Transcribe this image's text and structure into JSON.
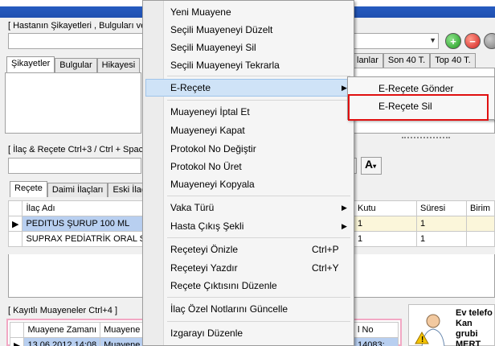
{
  "complaints_section": {
    "label": "[ Hastanın Şikayetleri , Bulguları ve",
    "tabs": [
      "Şikayetler",
      "Bulgular",
      "Hikayesi"
    ],
    "right_tabs": [
      "lanlar",
      "Son 40 T.",
      "Top 40 T."
    ]
  },
  "drug_section": {
    "label": "[ İlaç & Reçete Ctrl+3 / Ctrl + Spac",
    "font_button": "A",
    "tabs": [
      "Reçete",
      "Daimi İlaçları",
      "Eski İlaçla"
    ],
    "columns": {
      "drug": "İlaç Adı",
      "box": "Kutu",
      "duration": "Süresi",
      "unit": "Birim"
    },
    "rows": [
      {
        "drug": "PEDITUS ŞURUP 100 ML",
        "box": "1",
        "duration": "1",
        "selected": true
      },
      {
        "drug": "SUPRAX PEDİATRİK ORAL SÜ",
        "box": "1",
        "duration": "1",
        "selected": false
      }
    ]
  },
  "visits_section": {
    "label": "[ Kayıtlı Muayeneler Ctrl+4 ]",
    "columns": [
      "Muayene Zamanı",
      "Muayene",
      "l No"
    ],
    "row": {
      "time": "13.06.2012 14:08",
      "type": "Muayene",
      "no": "14083:"
    }
  },
  "patient_info": {
    "line1": "Ev telefo",
    "line2": "Kan grubi",
    "line3": "MERT ŞA"
  },
  "context_menu": {
    "items": [
      {
        "label": "Yeni Muayene"
      },
      {
        "label": "Seçili Muayeneyi Düzelt"
      },
      {
        "label": "Seçili Muayeneyi Sil"
      },
      {
        "label": "Seçili Muayeneyi Tekrarla"
      },
      {
        "label": "E-Reçete",
        "submenu": true
      },
      {
        "label": "Muayeneyi İptal Et"
      },
      {
        "label": "Muayeneyi Kapat"
      },
      {
        "label": "Protokol No Değiştir"
      },
      {
        "label": "Protokol No Üret"
      },
      {
        "label": "Muayeneyi Kopyala"
      },
      {
        "label": "Vaka Türü",
        "submenu": true
      },
      {
        "label": "Hasta Çıkış Şekli",
        "submenu": true
      },
      {
        "label": "Reçeteyi Önizle",
        "shortcut": "Ctrl+P"
      },
      {
        "label": "Reçeteyi Yazdır",
        "shortcut": "Ctrl+Y"
      },
      {
        "label": "Reçete Çıktısını Düzenle"
      },
      {
        "label": "İlaç Özel Notlarını Güncelle"
      },
      {
        "label": "Izgarayı Düzenle"
      }
    ]
  },
  "e_recete_submenu": {
    "items": [
      "E-Reçete Gönder",
      "E-Reçete Sil"
    ]
  },
  "colors": {
    "title_bar": "#1f4fb0",
    "menu_highlight": "#cfe3f7",
    "selected_row": "#b8cff0",
    "callout": "#e01010"
  }
}
